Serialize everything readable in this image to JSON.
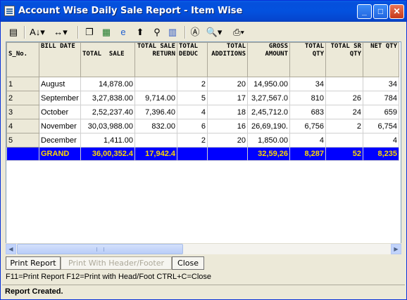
{
  "window": {
    "title": "Account Wise Daily Sale Report - Item Wise"
  },
  "columns": [
    "S_No.",
    "BILL DATE",
    "TOTAL  SALE",
    "TOTAL SALE RETURN",
    "TOTAL DEDUC",
    "TOTAL ADDITIONS",
    "GROSS AMOUNT",
    "TOTAL QTY",
    "TOTAL SR QTY",
    "NET QTY"
  ],
  "rows": [
    {
      "sno": "1",
      "bill_date": "August",
      "total_sale": "14,878.00",
      "sale_return": "",
      "deduc": "2",
      "additions": "20",
      "gross": "14,950.00",
      "qty": "34",
      "sr_qty": "",
      "net_qty": "34"
    },
    {
      "sno": "2",
      "bill_date": "September",
      "total_sale": "3,27,838.00",
      "sale_return": "9,714.00",
      "deduc": "5",
      "additions": "17",
      "gross": "3,27,567.0",
      "qty": "810",
      "sr_qty": "26",
      "net_qty": "784"
    },
    {
      "sno": "3",
      "bill_date": "October",
      "total_sale": "2,52,237.40",
      "sale_return": "7,396.40",
      "deduc": "4",
      "additions": "18",
      "gross": "2,45,712.0",
      "qty": "683",
      "sr_qty": "24",
      "net_qty": "659"
    },
    {
      "sno": "4",
      "bill_date": "November",
      "total_sale": "30,03,988.00",
      "sale_return": "832.00",
      "deduc": "6",
      "additions": "16",
      "gross": "26,69,190.",
      "qty": "6,756",
      "sr_qty": "2",
      "net_qty": "6,754"
    },
    {
      "sno": "5",
      "bill_date": "December",
      "total_sale": "1,411.00",
      "sale_return": "",
      "deduc": "2",
      "additions": "20",
      "gross": "1,850.00",
      "qty": "4",
      "sr_qty": "",
      "net_qty": "4"
    }
  ],
  "total_row": {
    "sno": "",
    "bill_date": "GRAND",
    "total_sale": "36,00,352.4",
    "sale_return": "17,942.4",
    "deduc": "",
    "additions": "",
    "gross": "32,59,26",
    "qty": "8,287",
    "sr_qty": "52",
    "net_qty": "8,235"
  },
  "buttons": {
    "print_report": "Print Report",
    "print_header_footer": "Print With Header/Footer",
    "close": "Close"
  },
  "hint": "F11=Print Report  F12=Print with Head/Foot  CTRL+C=Close",
  "status": "Report Created.",
  "toolbar_icons": [
    "report-icon",
    "sort-icon",
    "column-width-icon",
    "copy-icon",
    "excel-icon",
    "internet-explorer-icon",
    "up-arrow-icon",
    "find-icon",
    "chart-icon",
    "font-icon",
    "print-preview-icon",
    "printer-icon"
  ]
}
